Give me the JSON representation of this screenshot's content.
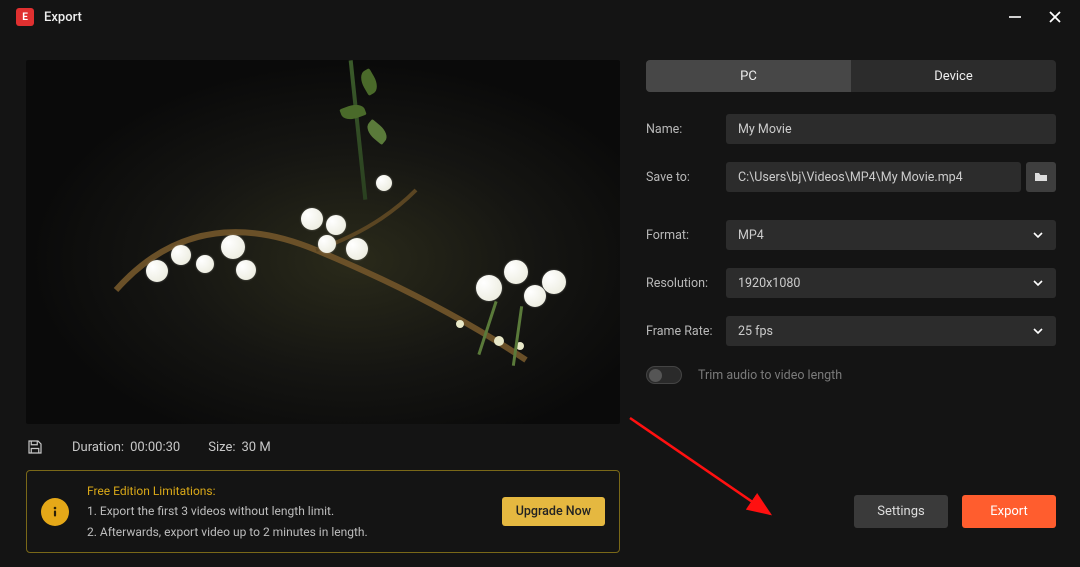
{
  "titlebar": {
    "title": "Export",
    "app_letter": "E"
  },
  "tabs": {
    "pc": "PC",
    "device": "Device"
  },
  "form": {
    "name_label": "Name:",
    "name_value": "My Movie",
    "saveto_label": "Save to:",
    "saveto_value": "C:\\Users\\bj\\Videos\\MP4\\My Movie.mp4",
    "format_label": "Format:",
    "format_value": "MP4",
    "resolution_label": "Resolution:",
    "resolution_value": "1920x1080",
    "framerate_label": "Frame Rate:",
    "framerate_value": "25 fps",
    "trim_label": "Trim audio to video length"
  },
  "meta": {
    "duration_label": "Duration:",
    "duration_value": "00:00:30",
    "size_label": "Size:",
    "size_value": "30 M"
  },
  "limitations": {
    "title": "Free Edition Limitations:",
    "line1": "1. Export the first 3 videos without length limit.",
    "line2": "2. Afterwards, export video up to 2 minutes in length.",
    "upgrade": "Upgrade Now"
  },
  "actions": {
    "settings": "Settings",
    "export": "Export"
  }
}
